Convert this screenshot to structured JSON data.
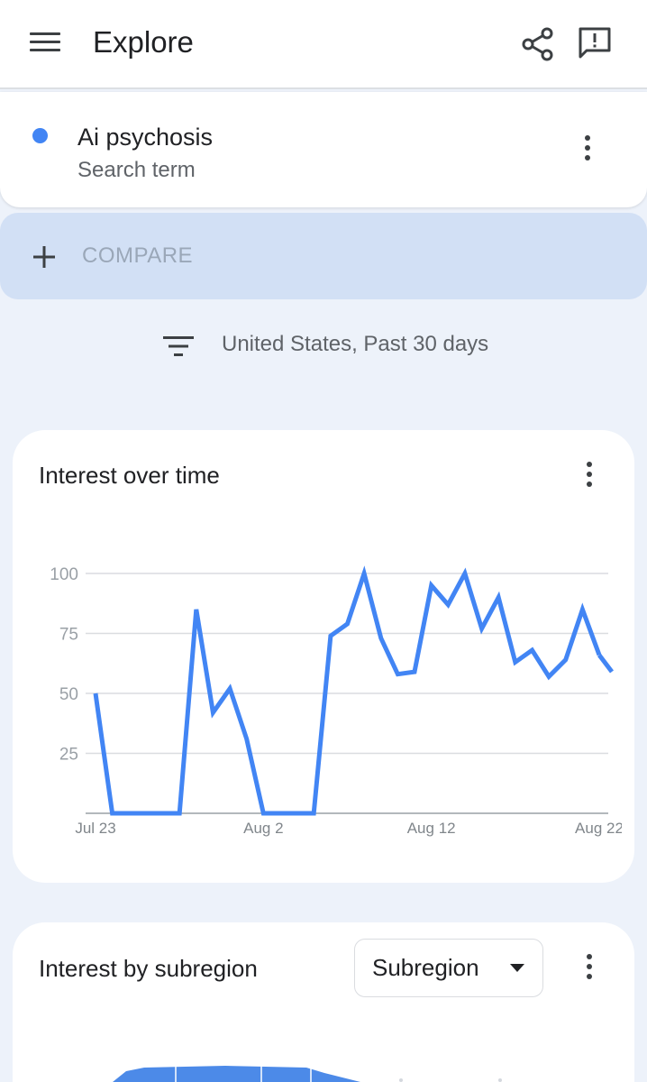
{
  "header": {
    "title": "Explore"
  },
  "search_term": {
    "name": "Ai psychosis",
    "type": "Search term",
    "color": "#4285f4"
  },
  "compare": {
    "label": "COMPARE"
  },
  "filter": {
    "text": "United States, Past 30 days"
  },
  "interest_over_time": {
    "title": "Interest over time"
  },
  "interest_by_subregion": {
    "title": "Interest by subregion",
    "select_value": "Subregion"
  },
  "chart_data": {
    "type": "line",
    "title": "Interest over time",
    "xlabel": "",
    "ylabel": "",
    "x_tick_labels": [
      "Jul 23",
      "Aug 2",
      "Aug 12",
      "Aug 22"
    ],
    "x_tick_indices": [
      0,
      10,
      20,
      30
    ],
    "y_ticks": [
      100,
      75,
      50,
      25
    ],
    "ylim": [
      0,
      100
    ],
    "grid": true,
    "series": [
      {
        "color": "#4285f4",
        "x": [
          "Jul 23",
          "Jul 24",
          "Jul 25",
          "Jul 26",
          "Jul 27",
          "Jul 28",
          "Jul 29",
          "Jul 30",
          "Jul 31",
          "Aug 1",
          "Aug 2",
          "Aug 3",
          "Aug 4",
          "Aug 5",
          "Aug 6",
          "Aug 7",
          "Aug 8",
          "Aug 9",
          "Aug 10",
          "Aug 11",
          "Aug 12",
          "Aug 13",
          "Aug 14",
          "Aug 15",
          "Aug 16",
          "Aug 17",
          "Aug 18",
          "Aug 19",
          "Aug 20",
          "Aug 21",
          "Aug 22"
        ],
        "values": [
          50,
          0,
          0,
          0,
          0,
          0,
          85,
          42,
          52,
          31,
          0,
          0,
          0,
          0,
          74,
          79,
          100,
          73,
          58,
          59,
          95,
          87,
          100,
          77,
          90,
          63,
          68,
          57,
          64,
          85,
          66
        ]
      }
    ],
    "last_value": 59
  }
}
